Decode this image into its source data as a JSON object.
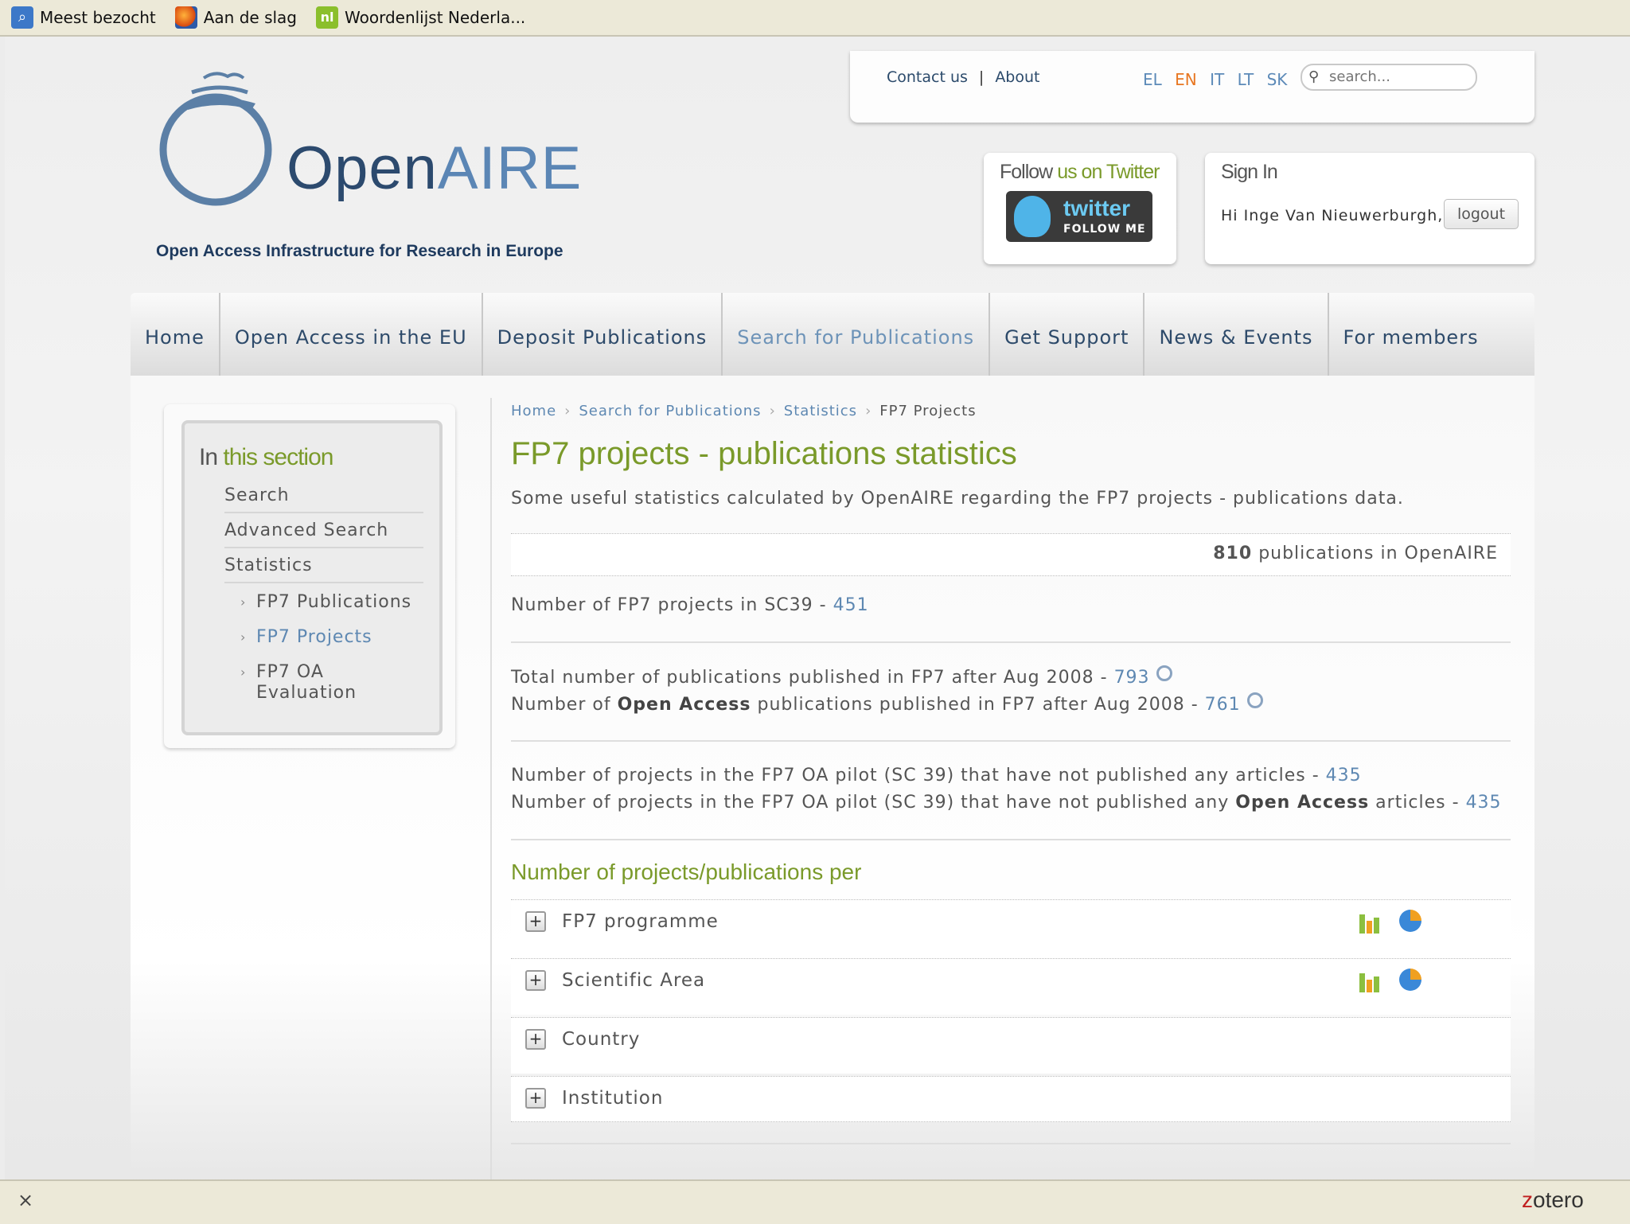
{
  "bookmarks": [
    {
      "label": "Meest bezocht",
      "icon": "most-visited-icon"
    },
    {
      "label": "Aan de slag",
      "icon": "firefox-icon"
    },
    {
      "label": "Woordenlijst Nederla...",
      "icon": "wordlist-icon"
    }
  ],
  "utility": {
    "contact": "Contact us",
    "separator": "|",
    "about": "About",
    "languages": [
      "EL",
      "EN",
      "IT",
      "LT",
      "SK"
    ],
    "active_language": "EN",
    "search_placeholder": "search..."
  },
  "logo": {
    "name_open": "Open",
    "name_aire": "AIRE",
    "tagline": "Open Access Infrastructure for Research in Europe"
  },
  "twitter": {
    "title_plain": "Follow",
    "title_hl": "us on Twitter",
    "button_word": "twitter",
    "button_sub": "FOLLOW ME"
  },
  "signin": {
    "title": "Sign In",
    "greeting": "Hi Inge Van Nieuwerburgh,",
    "logout": "logout"
  },
  "nav": {
    "items": [
      "Home",
      "Open Access in the EU",
      "Deposit Publications",
      "Search for Publications",
      "Get Support",
      "News & Events",
      "For members"
    ],
    "active": "Search for Publications"
  },
  "sidebar": {
    "title_plain": "In",
    "title_hl": "this section",
    "items": [
      "Search",
      "Advanced Search",
      "Statistics"
    ],
    "sub_items": [
      "FP7 Publications",
      "FP7 Projects",
      "FP7 OA Evaluation"
    ],
    "active_sub": "FP7 Projects"
  },
  "breadcrumb": {
    "items": [
      "Home",
      "Search for Publications",
      "Statistics"
    ],
    "current": "FP7 Projects",
    "sep": "›"
  },
  "main": {
    "title": "FP7 projects - publications statistics",
    "intro": "Some useful statistics calculated by OpenAIRE regarding the FP7 projects - publications data.",
    "total_count": "810",
    "total_label": "publications in OpenAIRE",
    "projects_label": "Number of FP7 projects in SC39 - ",
    "projects_value": "451",
    "pubs_label": "Total number of publications published in FP7 after Aug 2008 - ",
    "pubs_value": "793",
    "oa_pre": "Number of ",
    "oa_bold": "Open Access",
    "oa_post": " publications published in FP7 after Aug 2008 - ",
    "oa_value": "761",
    "nopub_label": "Number of projects in the FP7 OA pilot (SC 39) that have not published any articles - ",
    "nopub_value": "435",
    "nooa_pre": "Number of projects in the FP7 OA pilot (SC 39) that have not published any ",
    "nooa_bold": "Open Access",
    "nooa_post": " articles - ",
    "nooa_value": "435",
    "per_title": "Number of projects/publications per",
    "per_rows": [
      "FP7 programme",
      "Scientific Area",
      "Country",
      "Institution"
    ]
  },
  "statusbar": {
    "close": "×",
    "zotero_z": "z",
    "zotero_rest": "otero"
  },
  "colors": {
    "accent_green": "#7a9a2a",
    "link_blue": "#5e88b2",
    "nav_text": "#2d4a6a",
    "lang_active": "#e87722"
  }
}
